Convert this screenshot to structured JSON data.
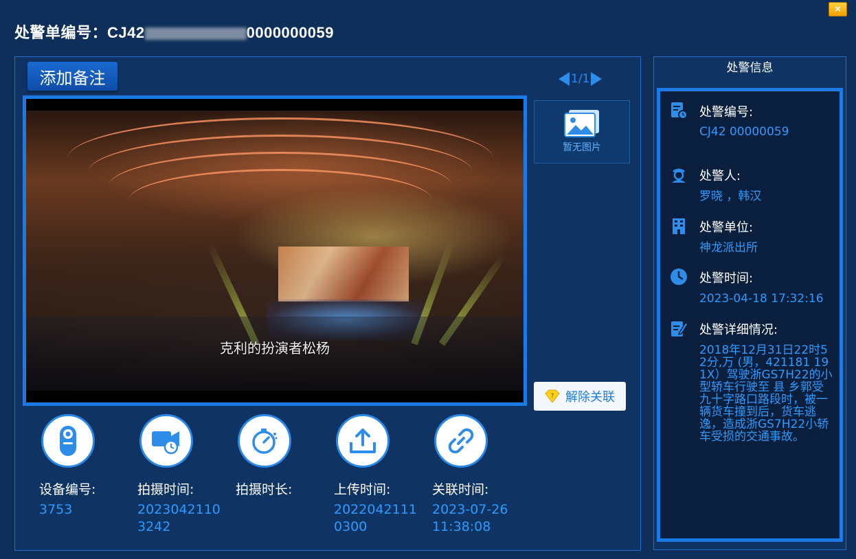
{
  "window": {
    "close_label": "×",
    "title_label": "处警单编号：",
    "title_prefix": "CJ42",
    "title_suffix": "0000000059"
  },
  "toolbar": {
    "add_note_label": "添加备注",
    "pager_text": "1/1"
  },
  "video": {
    "subtitle": "克利的扮演者松杨"
  },
  "gallery": {
    "empty_label": "暂无图片"
  },
  "actions": {
    "unlink_label": "解除关联"
  },
  "details": [
    {
      "icon": "device-camera-icon",
      "label": "设备编号:",
      "value": "3753"
    },
    {
      "icon": "video-camera-icon",
      "label": "拍摄时间:",
      "value": "20230421103242"
    },
    {
      "icon": "stopwatch-icon",
      "label": "拍摄时长:",
      "value": ""
    },
    {
      "icon": "upload-icon",
      "label": "上传时间:",
      "value": "20220421110300"
    },
    {
      "icon": "link-icon",
      "label": "关联时间:",
      "value": "2023-07-26 11:38:08"
    }
  ],
  "alarm_info": {
    "header": "处警信息",
    "fields": [
      {
        "icon": "document-clock-icon",
        "label": "处警编号:",
        "value": "CJ42                              00000059"
      },
      {
        "icon": "officer-icon",
        "label": "处警人:",
        "value": "罗晓    ，韩汉   "
      },
      {
        "icon": "building-icon",
        "label": "处警单位:",
        "value": "神龙派出所"
      },
      {
        "icon": "clock-icon",
        "label": "处警时间:",
        "value": "2023-04-18 17:32:16"
      },
      {
        "icon": "edit-document-icon",
        "label": "处警详细情况:",
        "value": "2018年12月31日22时52分,万    (男，421181        191X）驾驶浙GS7H22的小型轿车行驶至    县     乡郭受九十字路口路段时，被一辆货车撞到后，货车逃逸，造成浙GS7H22小轿车受损的交通事故。"
      }
    ]
  },
  "colors": {
    "background": "#0e2f5a",
    "accent": "#1c7ae6",
    "value_text": "#2e9bff",
    "close_button": "#f0a000"
  }
}
